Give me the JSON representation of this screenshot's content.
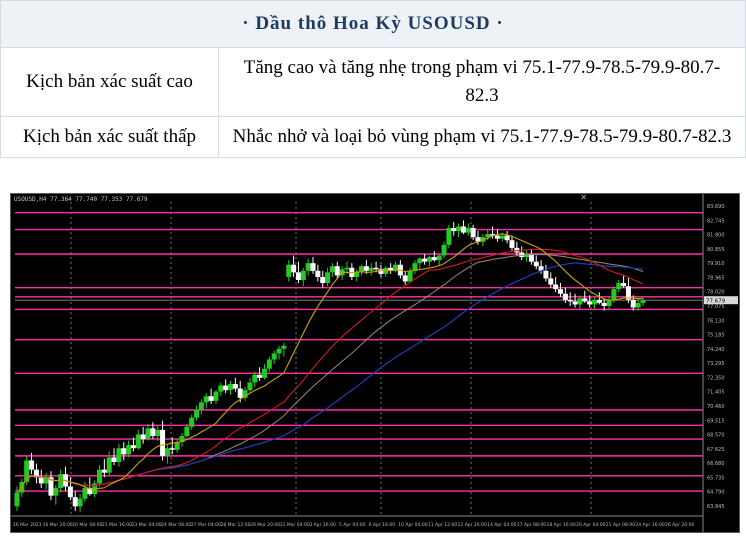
{
  "header": {
    "title": "· Dầu thô Hoa Kỳ USOUSD ·"
  },
  "scenarios": [
    {
      "label": "Kịch bản xác suất cao",
      "value": "Tăng cao và tăng nhẹ trong phạm vi 75.1-77.9-78.5-79.9-80.7-82.3"
    },
    {
      "label": "Kịch bản xác suất thấp",
      "value": "Nhắc nhở và loại bỏ vùng phạm vi 75.1-77.9-78.5-79.9-80.7-82.3"
    }
  ],
  "chart": {
    "header_text": "USOUSD,H4  77.364 77.740 77.353 77.679",
    "close_glyph": "✕",
    "colors": {
      "background": "#000000",
      "bull": "#26c826",
      "bear": "#ffffff",
      "level": "#ff2fa8",
      "ma_fast": "#c8a400",
      "ma_mid": "#d21c1c",
      "ma_slow": "#9c8a6a",
      "ma_blue": "#1f3fb5"
    }
  },
  "chart_data": {
    "type": "candlestick",
    "symbol": "USOUSD",
    "timeframe": "H4",
    "y_ticks": [
      "83.690",
      "82.745",
      "81.800",
      "80.855",
      "79.910",
      "78.965",
      "78.020",
      "77.075",
      "76.130",
      "75.185",
      "74.240",
      "73.295",
      "72.350",
      "71.405",
      "70.460",
      "69.515",
      "68.570",
      "67.625",
      "66.680",
      "65.735",
      "64.790",
      "63.845"
    ],
    "x_ticks": [
      "16 Mar 2023",
      "16 Mar 20:00",
      "20 Mar 08:00",
      "21 Mar 16:00",
      "23 Mar 04:00",
      "24 Mar 08:00",
      "27 Mar 04:00",
      "28 Mar 12:00",
      "29 Mar 20:00",
      "31 Mar 04:00",
      "3 Apr 16:00",
      "5 Apr 04:00",
      "6 Apr 16:00",
      "10 Apr 04:00",
      "11 Apr 12:00",
      "12 Apr 20:00",
      "14 Apr 04:00",
      "17 Apr 08:00",
      "18 Apr 16:00",
      "20 Apr 04:00",
      "21 Apr 08:00",
      "24 Apr 16:00",
      "26 Apr 20:00"
    ],
    "levels": [
      83.4,
      82.3,
      80.7,
      78.5,
      77.9,
      77.075,
      75.1,
      72.9,
      70.5,
      69.5,
      68.6,
      67.5,
      66.2,
      65.2
    ],
    "current_price": 77.679,
    "ylim": [
      63.7,
      84.1
    ],
    "vertical_grid": [
      60,
      160,
      285,
      370,
      460,
      580
    ],
    "candles": [
      [
        64.2,
        65.5,
        63.9,
        65.1
      ],
      [
        65.1,
        66.0,
        64.8,
        65.8
      ],
      [
        65.8,
        67.5,
        65.6,
        67.2
      ],
      [
        67.2,
        67.7,
        66.3,
        66.6
      ],
      [
        66.6,
        67.0,
        65.7,
        66.1
      ],
      [
        66.1,
        66.6,
        65.4,
        65.7
      ],
      [
        65.7,
        66.4,
        65.3,
        66.1
      ],
      [
        66.1,
        66.5,
        64.6,
        64.9
      ],
      [
        64.9,
        65.6,
        64.3,
        65.4
      ],
      [
        65.4,
        66.6,
        65.1,
        66.3
      ],
      [
        66.3,
        66.8,
        65.2,
        65.5
      ],
      [
        65.5,
        66.1,
        64.6,
        64.8
      ],
      [
        64.8,
        65.2,
        63.9,
        64.2
      ],
      [
        64.2,
        65.0,
        63.8,
        64.7
      ],
      [
        64.7,
        65.8,
        64.5,
        65.4
      ],
      [
        65.4,
        66.1,
        64.9,
        65.0
      ],
      [
        65.0,
        65.9,
        64.8,
        65.7
      ],
      [
        65.7,
        66.9,
        65.5,
        66.6
      ],
      [
        66.6,
        67.3,
        66.1,
        66.4
      ],
      [
        66.4,
        67.8,
        66.2,
        67.4
      ],
      [
        67.4,
        68.0,
        66.9,
        67.1
      ],
      [
        67.1,
        68.3,
        66.8,
        68.0
      ],
      [
        68.0,
        68.4,
        67.2,
        67.6
      ],
      [
        67.6,
        68.5,
        67.4,
        68.2
      ],
      [
        68.2,
        68.7,
        67.8,
        68.0
      ],
      [
        68.0,
        69.2,
        67.9,
        68.9
      ],
      [
        68.9,
        69.4,
        68.3,
        68.6
      ],
      [
        68.6,
        69.6,
        68.5,
        69.3
      ],
      [
        69.3,
        69.7,
        68.6,
        68.8
      ],
      [
        68.8,
        69.5,
        68.5,
        69.2
      ],
      [
        69.2,
        69.8,
        67.2,
        67.5
      ],
      [
        67.5,
        68.2,
        67.0,
        68.0
      ],
      [
        68.0,
        68.7,
        67.6,
        67.9
      ],
      [
        67.9,
        68.6,
        67.7,
        68.4
      ],
      [
        68.4,
        69.0,
        68.1,
        68.8
      ],
      [
        68.8,
        69.6,
        68.7,
        69.4
      ],
      [
        69.4,
        70.2,
        69.2,
        70.0
      ],
      [
        70.0,
        70.8,
        69.8,
        70.5
      ],
      [
        70.5,
        71.2,
        70.2,
        71.0
      ],
      [
        71.0,
        71.6,
        70.6,
        71.4
      ],
      [
        71.4,
        71.9,
        70.9,
        71.1
      ],
      [
        71.1,
        71.8,
        70.9,
        71.7
      ],
      [
        71.7,
        72.3,
        71.4,
        72.1
      ],
      [
        72.1,
        72.5,
        71.6,
        71.8
      ],
      [
        71.8,
        72.4,
        71.5,
        72.2
      ],
      [
        72.2,
        72.6,
        71.7,
        71.9
      ],
      [
        71.9,
        72.4,
        71.0,
        71.3
      ],
      [
        71.3,
        72.0,
        71.1,
        71.8
      ],
      [
        71.8,
        72.6,
        71.6,
        72.3
      ],
      [
        72.3,
        73.0,
        72.0,
        72.8
      ],
      [
        72.8,
        73.3,
        72.4,
        72.6
      ],
      [
        72.6,
        73.5,
        72.5,
        73.2
      ],
      [
        73.2,
        74.0,
        73.0,
        73.8
      ],
      [
        73.8,
        74.4,
        73.5,
        74.2
      ],
      [
        74.2,
        74.7,
        73.8,
        74.5
      ],
      [
        74.5,
        74.9,
        74.0,
        74.7
      ],
      [
        79.2,
        80.3,
        78.9,
        80.0
      ],
      [
        80.0,
        80.6,
        79.2,
        79.5
      ],
      [
        79.5,
        80.2,
        78.8,
        79.0
      ],
      [
        79.0,
        79.8,
        78.6,
        79.6
      ],
      [
        79.6,
        80.4,
        79.3,
        80.1
      ],
      [
        80.1,
        80.5,
        79.4,
        79.6
      ],
      [
        79.6,
        80.0,
        78.9,
        79.2
      ],
      [
        79.2,
        79.6,
        78.5,
        78.8
      ],
      [
        78.8,
        79.8,
        78.6,
        79.5
      ],
      [
        79.5,
        80.1,
        79.2,
        79.9
      ],
      [
        79.9,
        80.2,
        79.1,
        79.3
      ],
      [
        79.3,
        79.9,
        79.0,
        79.7
      ],
      [
        79.7,
        80.2,
        79.4,
        79.8
      ],
      [
        79.8,
        80.1,
        79.0,
        79.2
      ],
      [
        79.2,
        79.7,
        78.9,
        79.5
      ],
      [
        79.5,
        80.0,
        79.3,
        79.9
      ],
      [
        79.9,
        80.3,
        79.4,
        79.6
      ],
      [
        79.6,
        80.1,
        79.3,
        79.8
      ],
      [
        79.8,
        80.2,
        79.5,
        79.7
      ],
      [
        79.7,
        80.0,
        79.2,
        79.4
      ],
      [
        79.4,
        79.9,
        79.2,
        79.8
      ],
      [
        79.8,
        80.1,
        79.4,
        79.6
      ],
      [
        79.6,
        80.2,
        79.5,
        80.0
      ],
      [
        80.0,
        80.3,
        79.1,
        79.3
      ],
      [
        79.3,
        79.6,
        78.7,
        78.9
      ],
      [
        78.9,
        79.8,
        78.8,
        79.6
      ],
      [
        79.6,
        80.3,
        79.4,
        80.1
      ],
      [
        80.1,
        80.5,
        79.7,
        80.4
      ],
      [
        80.4,
        80.7,
        80.0,
        80.2
      ],
      [
        80.2,
        80.6,
        79.9,
        80.5
      ],
      [
        80.5,
        80.9,
        80.2,
        80.3
      ],
      [
        80.3,
        80.7,
        79.9,
        80.6
      ],
      [
        80.6,
        81.5,
        80.4,
        81.3
      ],
      [
        81.3,
        82.6,
        81.1,
        82.4
      ],
      [
        82.4,
        82.8,
        81.9,
        82.2
      ],
      [
        82.2,
        82.7,
        81.8,
        82.5
      ],
      [
        82.5,
        82.9,
        82.0,
        82.1
      ],
      [
        82.1,
        82.7,
        81.9,
        82.4
      ],
      [
        82.4,
        82.6,
        81.6,
        81.8
      ],
      [
        81.8,
        82.2,
        81.3,
        81.5
      ],
      [
        81.5,
        82.0,
        81.2,
        81.8
      ],
      [
        81.8,
        82.3,
        81.6,
        82.0
      ],
      [
        82.0,
        82.5,
        81.7,
        81.9
      ],
      [
        81.9,
        82.3,
        81.5,
        81.7
      ],
      [
        81.7,
        82.1,
        81.5,
        81.9
      ],
      [
        81.9,
        82.2,
        81.4,
        81.6
      ],
      [
        81.6,
        81.9,
        80.9,
        81.1
      ],
      [
        81.1,
        81.5,
        80.6,
        80.8
      ],
      [
        80.8,
        81.2,
        80.3,
        80.5
      ],
      [
        80.5,
        81.0,
        80.2,
        80.7
      ],
      [
        80.7,
        81.0,
        80.0,
        80.2
      ],
      [
        80.2,
        80.6,
        79.7,
        79.9
      ],
      [
        79.9,
        80.3,
        79.4,
        79.6
      ],
      [
        79.6,
        80.0,
        78.9,
        79.1
      ],
      [
        79.1,
        79.5,
        78.5,
        78.7
      ],
      [
        78.7,
        79.2,
        78.2,
        78.4
      ],
      [
        78.4,
        78.8,
        77.9,
        78.1
      ],
      [
        78.1,
        78.5,
        77.5,
        77.7
      ],
      [
        77.7,
        78.2,
        77.3,
        77.6
      ],
      [
        77.6,
        78.1,
        77.2,
        77.4
      ],
      [
        77.4,
        78.0,
        77.1,
        77.8
      ],
      [
        77.8,
        78.3,
        77.5,
        77.6
      ],
      [
        77.6,
        78.0,
        77.2,
        77.4
      ],
      [
        77.4,
        77.9,
        77.1,
        77.7
      ],
      [
        77.7,
        78.2,
        77.4,
        77.5
      ],
      [
        77.5,
        77.8,
        77.0,
        77.3
      ],
      [
        77.3,
        77.9,
        77.1,
        77.7
      ],
      [
        77.7,
        78.6,
        77.5,
        78.4
      ],
      [
        78.4,
        79.0,
        78.2,
        78.8
      ],
      [
        78.8,
        79.3,
        78.5,
        78.6
      ],
      [
        78.6,
        79.2,
        77.5,
        77.7
      ],
      [
        77.7,
        78.0,
        77.0,
        77.2
      ],
      [
        77.2,
        77.8,
        77.0,
        77.5
      ],
      [
        77.5,
        77.9,
        77.3,
        77.68
      ]
    ]
  }
}
